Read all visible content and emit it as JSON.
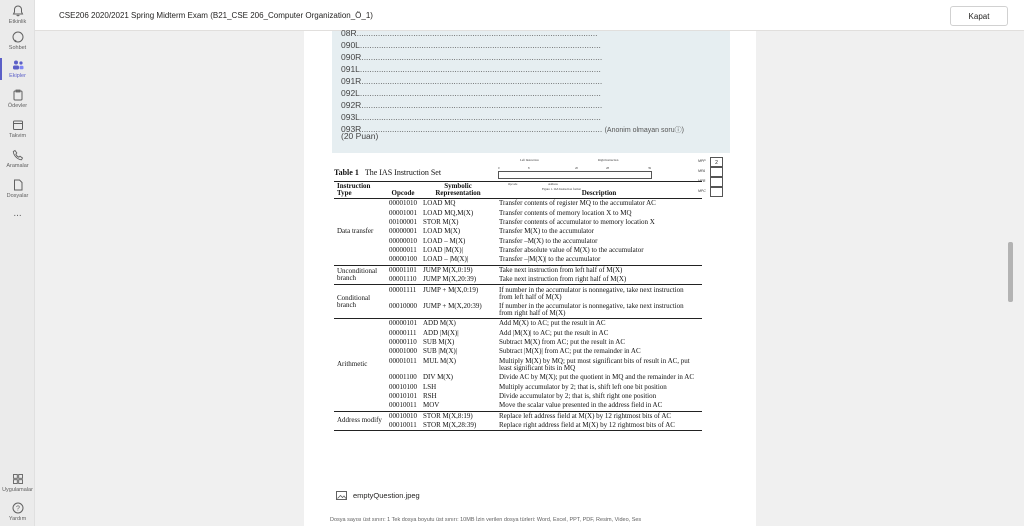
{
  "rail": {
    "items": [
      {
        "label": "Etkinlik",
        "icon": "bell-icon"
      },
      {
        "label": "Sohbet",
        "icon": "chat-icon"
      },
      {
        "label": "Ekipler",
        "icon": "teams-icon"
      },
      {
        "label": "Ödevler",
        "icon": "assignments-icon"
      },
      {
        "label": "Takvim",
        "icon": "calendar-icon"
      },
      {
        "label": "Aramalar",
        "icon": "phone-icon"
      },
      {
        "label": "Dosyalar",
        "icon": "files-icon"
      },
      {
        "label": "...",
        "icon": "more-icon"
      }
    ],
    "bottom": [
      {
        "label": "Uygulamalar",
        "icon": "apps-icon"
      },
      {
        "label": "Yardım",
        "icon": "help-icon"
      }
    ]
  },
  "header": {
    "title": "CSE206 2020/2021 Spring Midterm Exam (B21_CSE 206_Computer Organization_Ö_1)",
    "close_label": "Kapat"
  },
  "question": {
    "lines": [
      "08R",
      "090L",
      "090R",
      "091L",
      "091R",
      "092L",
      "092R",
      "093L",
      "093R"
    ],
    "dots": "......................................................................................................",
    "anonymous_note": "(Anonim olmayan soruⓘ)",
    "points": "(20 Puan)"
  },
  "figure": {
    "table_label": "Table 1",
    "table_title": "The IAS Instruction Set",
    "mini_figure": {
      "left_label": "Left Instruction",
      "right_label": "Right Instruction",
      "ticks": [
        "0",
        "8",
        "20",
        "28",
        "39"
      ],
      "opcode": "Opcode",
      "address": "Address",
      "caption": "Figure 1. IAS Instruction format"
    },
    "registers": [
      {
        "name": "MPP",
        "value": "2"
      },
      {
        "name": "MFA",
        "value": ""
      },
      {
        "name": "MFB",
        "value": ""
      },
      {
        "name": "MPC",
        "value": ""
      }
    ],
    "headers": [
      "Instruction Type",
      "Opcode",
      "Symbolic Representation",
      "Description"
    ],
    "groups": [
      {
        "type": "Data transfer",
        "rows": [
          [
            "00001010",
            "LOAD MQ",
            "Transfer contents of register MQ to the accumulator AC"
          ],
          [
            "00001001",
            "LOAD MQ,M(X)",
            "Transfer contents of memory location X to MQ"
          ],
          [
            "00100001",
            "STOR M(X)",
            "Transfer contents of accumulator to memory location X"
          ],
          [
            "00000001",
            "LOAD M(X)",
            "Transfer M(X) to the accumulator"
          ],
          [
            "00000010",
            "LOAD – M(X)",
            "Transfer –M(X) to the accumulator"
          ],
          [
            "00000011",
            "LOAD |M(X)|",
            "Transfer absolute value of M(X) to the accumulator"
          ],
          [
            "00000100",
            "LOAD – |M(X)|",
            "Transfer –|M(X)| to the accumulator"
          ]
        ]
      },
      {
        "type": "Unconditional branch",
        "rows": [
          [
            "00001101",
            "JUMP M(X,0:19)",
            "Take next instruction from left half of M(X)"
          ],
          [
            "00001110",
            "JUMP M(X,20:39)",
            "Take next instruction from right half of M(X)"
          ]
        ]
      },
      {
        "type": "Conditional branch",
        "rows": [
          [
            "00001111",
            "JUMP + M(X,0:19)",
            "If number in the accumulator is nonnegative, take next instruction from left half of M(X)"
          ],
          [
            "00010000",
            "JUMP + M(X,20:39)",
            "If number in the accumulator is nonnegative, take next instruction from right half of M(X)"
          ]
        ]
      },
      {
        "type": "Arithmetic",
        "rows": [
          [
            "00000101",
            "ADD M(X)",
            "Add M(X) to AC; put the result in AC"
          ],
          [
            "00000111",
            "ADD |M(X)|",
            "Add |M(X)| to AC; put the result in AC"
          ],
          [
            "00000110",
            "SUB M(X)",
            "Subtract M(X) from AC; put the result in AC"
          ],
          [
            "00001000",
            "SUB |M(X)|",
            "Subtract |M(X)| from AC; put the remainder in AC"
          ],
          [
            "00001011",
            "MUL M(X)",
            "Multiply M(X) by MQ; put most significant bits of result in AC, put least significant bits in MQ"
          ],
          [
            "00001100",
            "DIV M(X)",
            "Divide AC by M(X); put the quotient in MQ and the remainder in AC"
          ],
          [
            "00010100",
            "LSH",
            "Multiply accumulator by 2; that is, shift left one bit position"
          ],
          [
            "00010101",
            "RSH",
            "Divide accumulator by 2; that is, shift right one position"
          ],
          [
            "00010011",
            "MOV",
            "Move the scalar value presented in the address field in AC"
          ]
        ]
      },
      {
        "type": "Address modify",
        "rows": [
          [
            "00010010",
            "STOR M(X,8:19)",
            "Replace left address field at M(X) by 12 rightmost bits of AC"
          ],
          [
            "00010011",
            "STOR M(X,28:39)",
            "Replace right address field at M(X) by 12 rightmost bits of AC"
          ]
        ]
      }
    ]
  },
  "attachment": {
    "filename": "emptyQuestion.jpeg",
    "icon": "image-icon"
  },
  "footer": "Dosya sayısı üst sınırı: 1   Tek dosya boyutu üst sınırı: 10MB   İzin verilen dosya türleri: Word, Excel, PPT, PDF, Resim, Video, Ses"
}
